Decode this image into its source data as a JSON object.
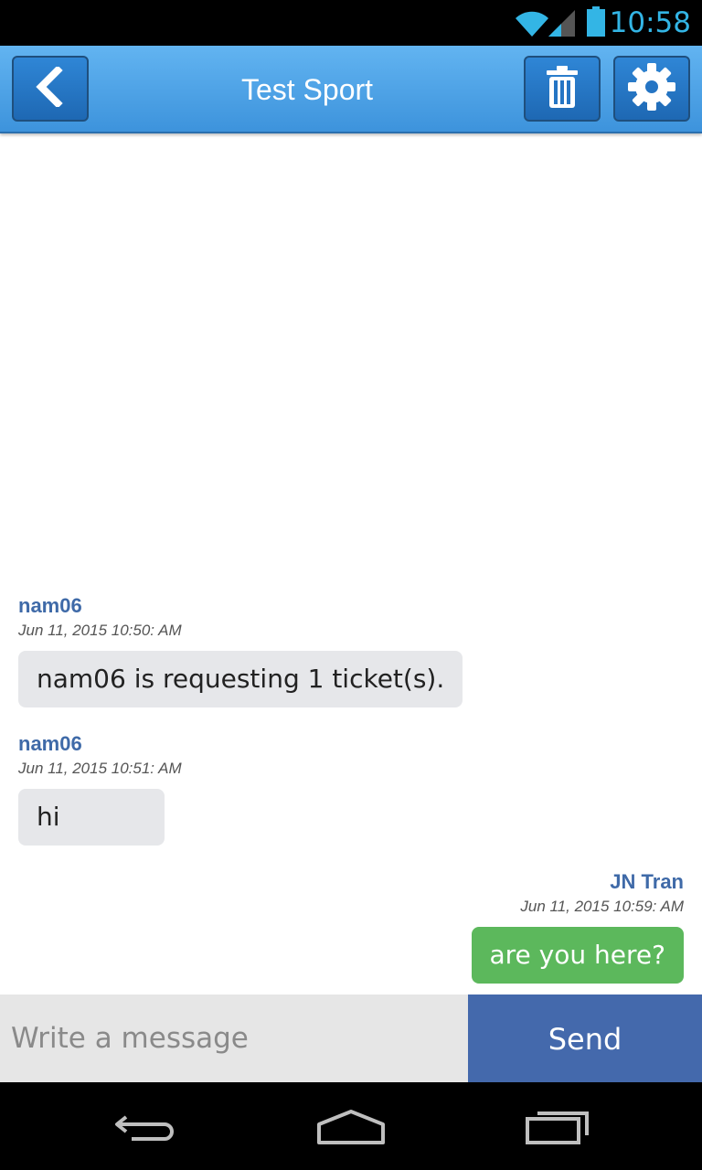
{
  "status_bar": {
    "time": "10:58",
    "icons": [
      "wifi-icon",
      "signal-icon",
      "battery-icon"
    ],
    "accent_color": "#33b5e5"
  },
  "header": {
    "title": "Test Sport",
    "icons": [
      "chevron-left-icon",
      "trash-icon",
      "gear-icon"
    ],
    "background_color": "#4aa3e8"
  },
  "messages": [
    {
      "sender": "nam06",
      "timestamp": "Jun 11, 2015 10:50: AM",
      "text": "nam06 is requesting 1 ticket(s).",
      "direction": "incoming"
    },
    {
      "sender": "nam06",
      "timestamp": "Jun 11, 2015 10:51: AM",
      "text": "hi",
      "direction": "incoming"
    },
    {
      "sender": "JN Tran",
      "timestamp": "Jun 11, 2015 10:59: AM",
      "text": "are you here?",
      "direction": "outgoing"
    }
  ],
  "composer": {
    "placeholder": "Write a message",
    "value": "",
    "send_label": "Send"
  },
  "colors": {
    "sender_name": "#3f6aa8",
    "incoming_bubble": "#e6e7ea",
    "outgoing_bubble": "#5cb85c",
    "send_button": "#4469ac"
  },
  "nav_bar": {
    "icons": [
      "back-nav-icon",
      "home-nav-icon",
      "recents-nav-icon"
    ]
  }
}
